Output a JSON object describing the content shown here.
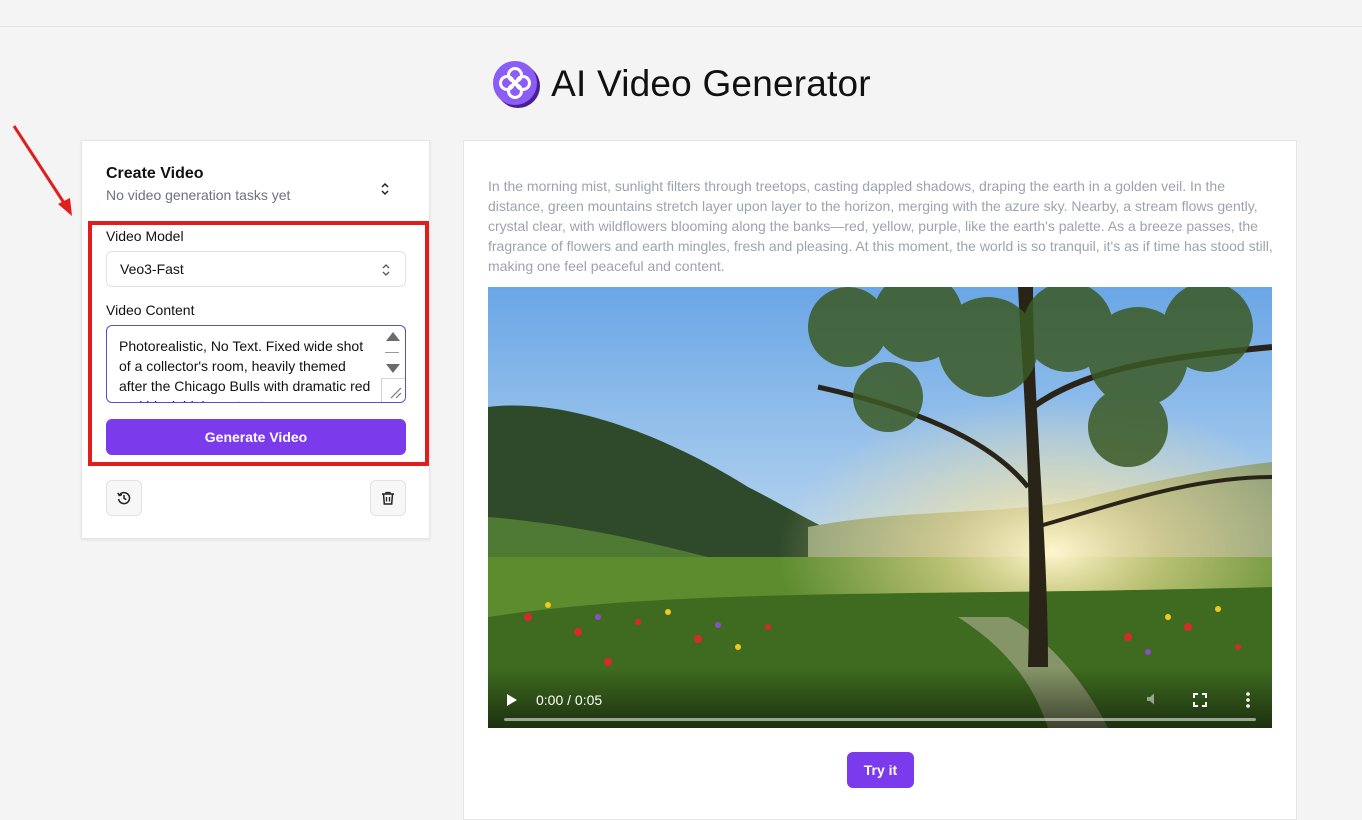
{
  "app": {
    "title": "AI Video Generator"
  },
  "create_panel": {
    "title": "Create Video",
    "subtitle": "No video generation tasks yet",
    "model_label": "Video Model",
    "model_value": "Veo3-Fast",
    "content_label": "Video Content",
    "content_value": "Photorealistic, No Text. Fixed wide shot of a collector's room, heavily themed after the Chicago Bulls with dramatic red and black high-contrast",
    "generate_label": "Generate Video"
  },
  "preview": {
    "prompt": "In the morning mist, sunlight filters through treetops, casting dappled shadows, draping the earth in a golden veil. In the distance, green mountains stretch layer upon layer to the horizon, merging with the azure sky. Nearby, a stream flows gently, crystal clear, with wildflowers blooming along the banks—red, yellow, purple, like the earth's palette. As a breeze passes, the fragrance of flowers and earth mingles, fresh and pleasing. At this moment, the world is so tranquil, it's as if time has stood still, making one feel peaceful and content.",
    "video_time": "0:00 / 0:05",
    "video_progress": 0,
    "try_label": "Try it"
  },
  "icons": {
    "logo": "flower-logo-icon",
    "toggle": "chevron-up-down-icon",
    "history": "history-icon",
    "delete": "trash-icon",
    "play": "play-icon",
    "mute": "volume-icon",
    "fullscreen": "fullscreen-icon",
    "more": "more-vertical-icon"
  },
  "colors": {
    "accent": "#7c3aed",
    "annotation": "#e11d1d"
  }
}
